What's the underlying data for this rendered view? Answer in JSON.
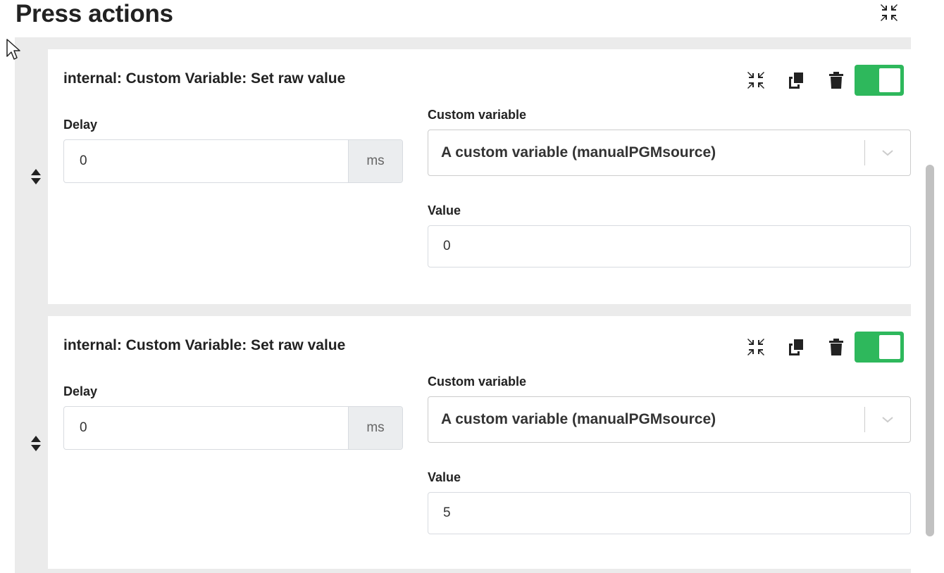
{
  "header": {
    "title": "Press actions",
    "collapse_icon": "compress-icon"
  },
  "actions": [
    {
      "name": "internal: Custom Variable: Set raw value",
      "delay_label": "Delay",
      "delay_value": "0",
      "delay_unit": "ms",
      "custom_variable_label": "Custom variable",
      "custom_variable_value": "A custom variable (manualPGMsource)",
      "value_label": "Value",
      "value_value": "0",
      "enabled": true
    },
    {
      "name": "internal: Custom Variable: Set raw value",
      "delay_label": "Delay",
      "delay_value": "0",
      "delay_unit": "ms",
      "custom_variable_label": "Custom variable",
      "custom_variable_value": "A custom variable (manualPGMsource)",
      "value_label": "Value",
      "value_value": "5",
      "enabled": true
    }
  ],
  "colors": {
    "toggle_on": "#2eb85c",
    "addon_bg": "#ebedef",
    "panel_bg": "#ebebeb"
  }
}
